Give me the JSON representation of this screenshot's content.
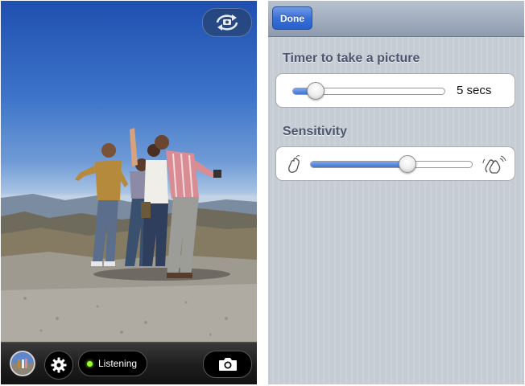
{
  "camera": {
    "status_label": "Listening",
    "status_color": "#9bff2e",
    "icons": [
      "camera-flip-icon",
      "photo-thumbnail",
      "gear-icon",
      "camera-icon"
    ]
  },
  "settings": {
    "done_label": "Done",
    "timer": {
      "title": "Timer to take a picture",
      "value_label": "5 secs",
      "level": 0.15
    },
    "sensitivity": {
      "title": "Sensitivity",
      "level": 0.6,
      "low_icon": "single-clap-hand-icon",
      "high_icon": "loud-clap-hands-icon"
    },
    "accent_color": "#3a6fd8"
  }
}
